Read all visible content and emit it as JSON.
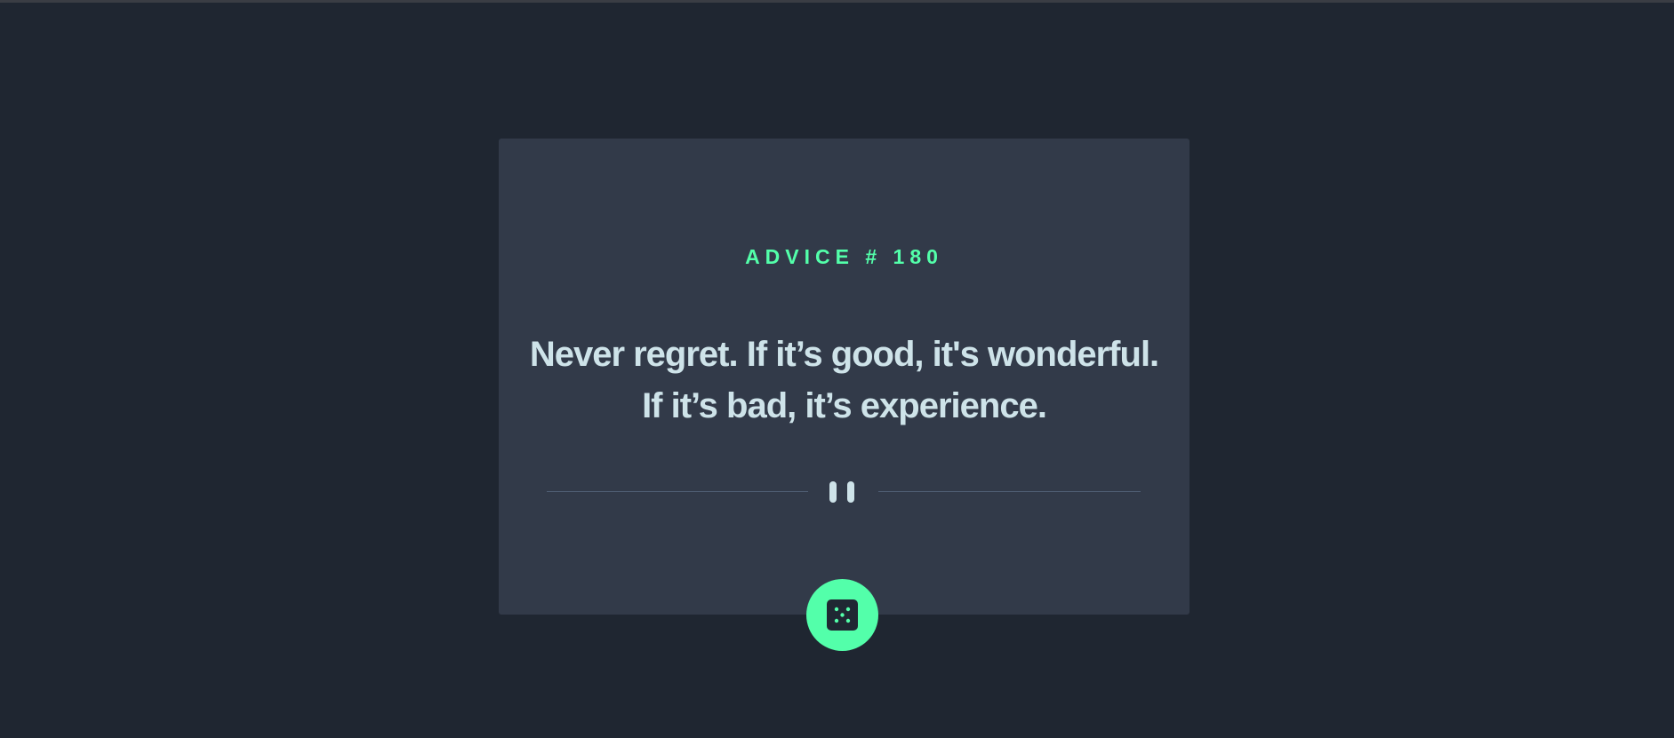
{
  "advice": {
    "id_label": "ADVICE # 180",
    "text": "Never regret. If it’s good, it's wonderful. If it’s bad, it’s experience."
  },
  "divider": {
    "icon": "pause-icon"
  },
  "generate_button": {
    "icon": "dice-icon"
  },
  "colors": {
    "background": "#1f2631",
    "card": "#323a49",
    "accent": "#53ffaa",
    "text": "#cee3e9",
    "divider": "#4f5d73"
  }
}
